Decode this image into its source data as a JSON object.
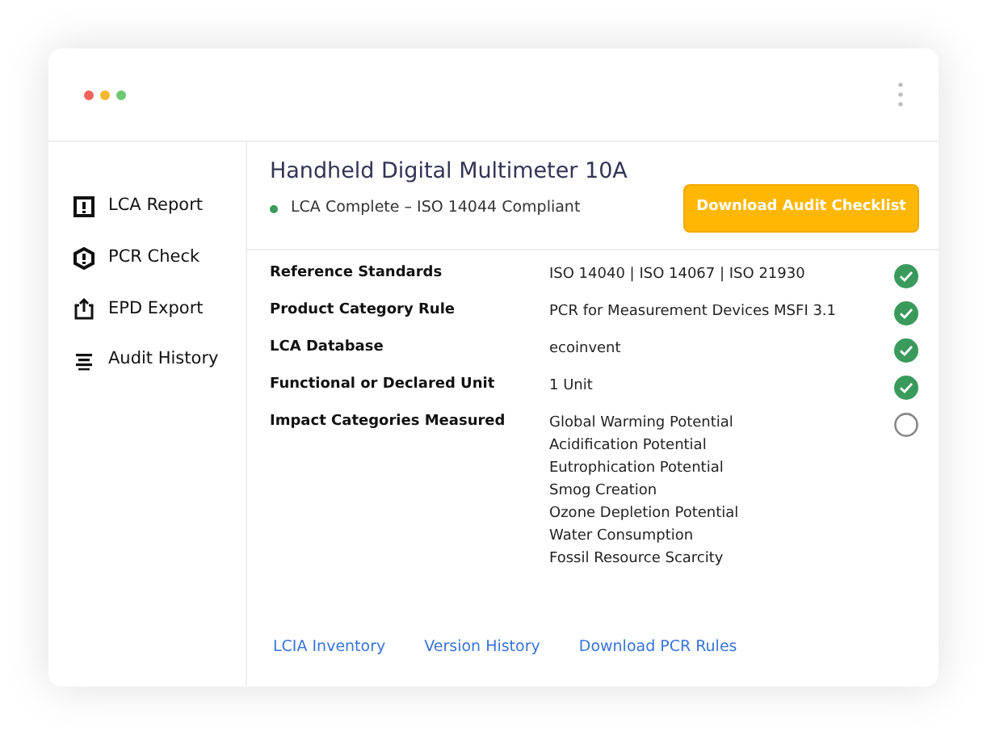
{
  "window": {
    "dots": [
      {
        "color": "#f0625a"
      },
      {
        "color": "#f5b731"
      },
      {
        "color": "#6cc873"
      }
    ]
  },
  "sidebar": {
    "items": [
      {
        "label": "LCA Report",
        "kind": "report"
      },
      {
        "label": "PCR Check",
        "kind": "check"
      },
      {
        "label": "EPD Export",
        "kind": "export"
      },
      {
        "label": "Audit History",
        "kind": "history"
      }
    ]
  },
  "product": {
    "title": "Handheld Digital Multimeter 10A",
    "status": "LCA Complete – ISO 14044 Compliant"
  },
  "action_button": "Download Audit Checklist",
  "rows": [
    {
      "label": "Reference Standards",
      "values": [
        "ISO 14040 | ISO 14067 | ISO 21930"
      ],
      "checked": true
    },
    {
      "label": "Product Category Rule",
      "values": [
        "PCR for Measurement Devices MSFI 3.1"
      ],
      "checked": true
    },
    {
      "label": "LCA Database",
      "values": [
        "ecoinvent"
      ],
      "checked": true
    },
    {
      "label": "Functional or Declared Unit",
      "values": [
        "1 Unit"
      ],
      "checked": true
    },
    {
      "label": "Impact Categories Measured",
      "values": [
        "Global Warming Potential",
        "Acidification Potential",
        "Eutrophication Potential",
        "Smog Creation",
        "Ozone Depletion Potential",
        "Water Consumption",
        "Fossil Resource Scarcity"
      ],
      "checked": false
    }
  ],
  "links": [
    "LCIA Inventory",
    "Version History",
    "Download PCR Rules"
  ]
}
